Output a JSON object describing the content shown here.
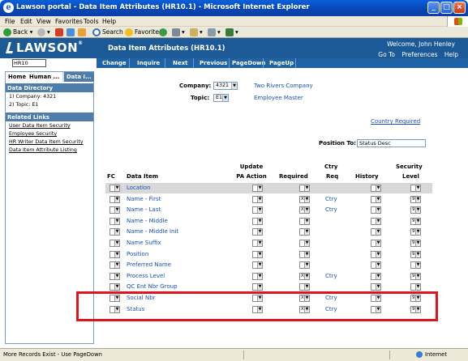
{
  "window": {
    "title": "Lawson portal - Data Item Attributes (HR10.1) - Microsoft Internet Explorer"
  },
  "menu": [
    "File",
    "Edit",
    "View",
    "Favorites",
    "Tools",
    "Help"
  ],
  "toolbar": {
    "back": "Back",
    "search": "Search",
    "favorites": "Favorites"
  },
  "header": {
    "logo": "LAWSON",
    "title": "Data Item Attributes (HR10.1)",
    "welcome": "Welcome, John Henley",
    "links": [
      "Go To",
      "Preferences",
      "Help"
    ]
  },
  "nav": {
    "input_value": "HR10",
    "buttons": [
      "Change",
      "Inquire",
      "Next",
      "Previous",
      "PageDown",
      "PageUp"
    ]
  },
  "sidebar": {
    "tabs": [
      "Home",
      "Human ...",
      "Data I..."
    ],
    "directory_title": "Data Directory",
    "directory_items": [
      "1) Company: 4321",
      "2) Topic: E1"
    ],
    "related_title": "Related Links",
    "related_links": [
      "User Data Item Security",
      "Employee Security",
      "HR Writer Data Item Security",
      "Data Item Attribute Listing"
    ]
  },
  "form": {
    "company_label": "Company:",
    "company_value": "4321",
    "company_name": "Two Rivers Company",
    "topic_label": "Topic:",
    "topic_value": "E1",
    "topic_name": "Employee Master",
    "country_required_link": "Country Required",
    "position_to_label": "Position To:",
    "position_to_value": "Status Desc"
  },
  "table": {
    "headers": {
      "fc": "FC",
      "data_item": "Data Item",
      "update_line1": "Update",
      "update_line2": "PA Action",
      "required": "Required",
      "ctry_line1": "Ctry",
      "ctry_line2": "Req",
      "history": "History",
      "security_line1": "Security",
      "security_line2": "Level"
    },
    "rows": [
      {
        "item": "Location",
        "required": "",
        "ctry": "",
        "level": ""
      },
      {
        "item": "Name - First",
        "required": "X",
        "ctry": "Ctry",
        "level": "9"
      },
      {
        "item": "Name - Last",
        "required": "X",
        "ctry": "Ctry",
        "level": "9"
      },
      {
        "item": "Name - Middle",
        "required": "",
        "ctry": "",
        "level": "9"
      },
      {
        "item": "Name - Middle Init",
        "required": "",
        "ctry": "",
        "level": "9"
      },
      {
        "item": "Name Suffix",
        "required": "",
        "ctry": "",
        "level": "9"
      },
      {
        "item": "Position",
        "required": "",
        "ctry": "",
        "level": "9"
      },
      {
        "item": "Preferred Name",
        "required": "",
        "ctry": "",
        "level": ""
      },
      {
        "item": "Process Level",
        "required": "X",
        "ctry": "Ctry",
        "level": "9"
      },
      {
        "item": "QC Ent Nbr Group",
        "required": "",
        "ctry": "",
        "level": ""
      },
      {
        "item": "Social Nbr",
        "required": "X",
        "ctry": "Ctry",
        "level": "9"
      },
      {
        "item": "Status",
        "required": "X",
        "ctry": "Ctry",
        "level": "9"
      }
    ]
  },
  "status": {
    "text": "More Records Exist - Use PageDown",
    "zone": "Internet"
  },
  "colors": {
    "header_blue": "#1b5a96",
    "nav_blue": "#2063a5",
    "highlight_red": "#e0141e",
    "link_blue": "#1a4fb8"
  }
}
